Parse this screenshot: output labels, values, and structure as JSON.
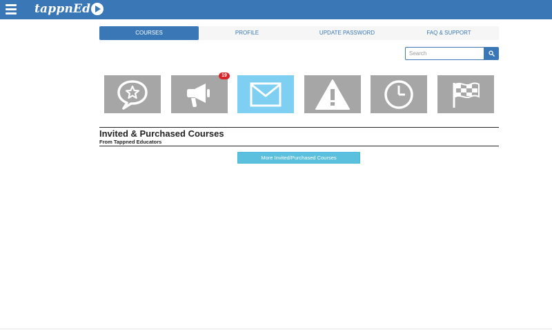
{
  "app": {
    "logo_text": "tappnEd",
    "brand_color": "#3a77b7"
  },
  "nav": {
    "tabs": [
      {
        "label": "COURSES",
        "active": true
      },
      {
        "label": "PROFILE",
        "active": false
      },
      {
        "label": "UPDATE PASSWORD",
        "active": false
      },
      {
        "label": "FAQ & SUPPORT",
        "active": false
      }
    ]
  },
  "search": {
    "placeholder": "Search",
    "value": ""
  },
  "icon_tiles": [
    {
      "icon": "star-speech-bubble-icon",
      "active": false
    },
    {
      "icon": "megaphone-icon",
      "active": false,
      "badge": "19"
    },
    {
      "icon": "envelope-icon",
      "active": true
    },
    {
      "icon": "warning-icon",
      "active": false
    },
    {
      "icon": "clock-icon",
      "active": false
    },
    {
      "icon": "checkered-flag-icon",
      "active": false
    }
  ],
  "section": {
    "title": "Invited & Purchased Courses",
    "subtitle": "From Tappned Educators",
    "more_button": "More Invited/Purchased Courses"
  }
}
